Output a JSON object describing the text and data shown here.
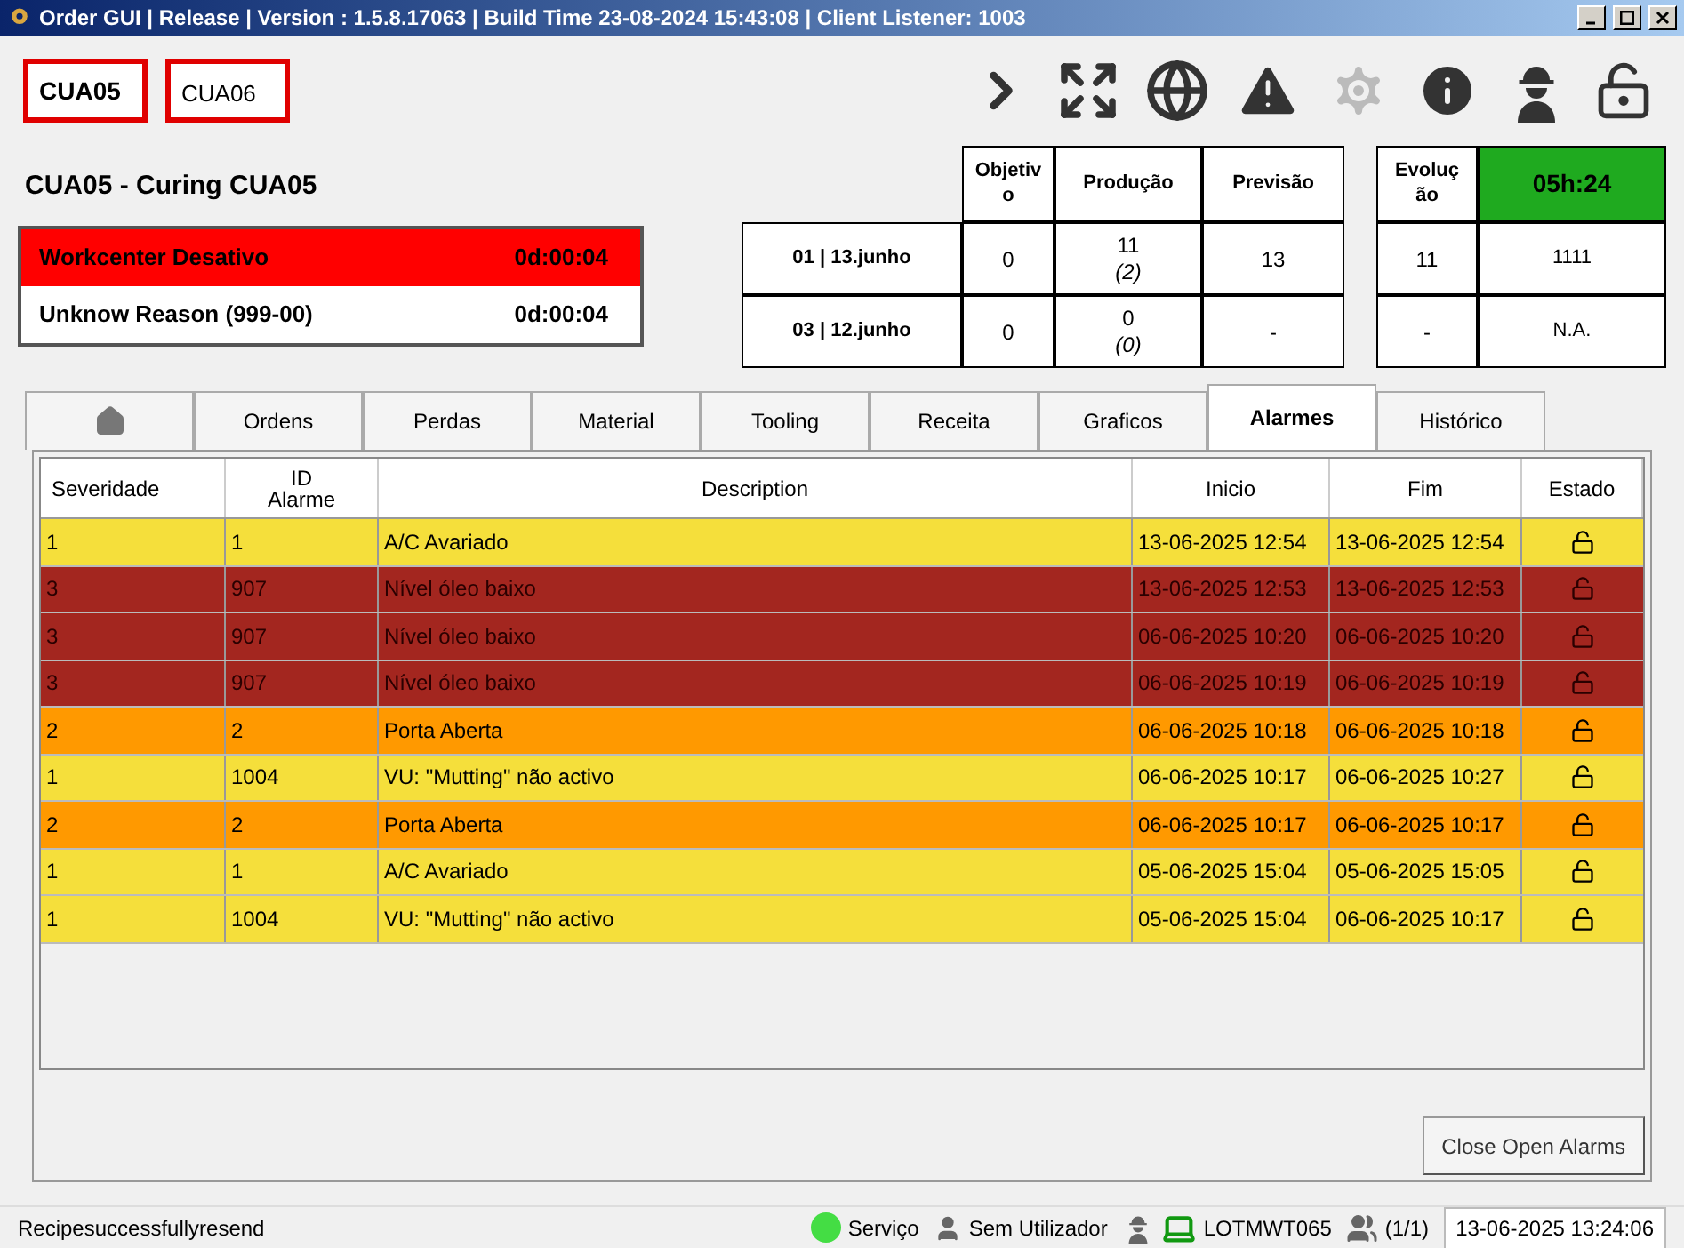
{
  "window": {
    "title": "Order GUI | Release | Version : 1.5.8.17063 | Build Time 23-08-2024 15:43:08 | Client Listener: 1003"
  },
  "stations": [
    {
      "label": "CUA05",
      "selected": true
    },
    {
      "label": "CUA06",
      "selected": false
    }
  ],
  "workcenter": {
    "title": "CUA05 - Curing CUA05",
    "states": [
      {
        "label": "Workcenter Desativo",
        "time": "0d:00:04",
        "color": "#ff0000"
      },
      {
        "label": "Unknow Reason (999-00)",
        "time": "0d:00:04",
        "color": "#ffffff"
      }
    ]
  },
  "stats": {
    "columns": [
      "Objetiv o",
      "Produção",
      "Previsão"
    ],
    "evolution_label": "Evoluç ão",
    "evolution_value": "05h:24",
    "rows": [
      {
        "shift": "01 | 13.junho",
        "objetivo": "0",
        "producao": "11",
        "producao_sub": "(2)",
        "previsao": "13",
        "evolucao": "11",
        "extra": "1111"
      },
      {
        "shift": "03 | 12.junho",
        "objetivo": "0",
        "producao": "0",
        "producao_sub": "(0)",
        "previsao": "-",
        "evolucao": "-",
        "extra": "N.A."
      }
    ]
  },
  "tabs": [
    {
      "kind": "home",
      "selected": false
    },
    {
      "kind": "text",
      "label": "Ordens",
      "selected": false
    },
    {
      "kind": "text",
      "label": "Perdas",
      "selected": false
    },
    {
      "kind": "text",
      "label": "Material",
      "selected": false
    },
    {
      "kind": "text",
      "label": "Tooling",
      "selected": false
    },
    {
      "kind": "text",
      "label": "Receita",
      "selected": false
    },
    {
      "kind": "text",
      "label": "Graficos",
      "selected": false
    },
    {
      "kind": "text",
      "label": "Alarmes",
      "selected": true
    },
    {
      "kind": "text",
      "label": "Histórico",
      "selected": false
    }
  ],
  "table": {
    "columns": [
      "Severidade",
      "ID Alarme",
      "Description",
      "Inicio",
      "Fim",
      "Estado"
    ],
    "rows": [
      {
        "severity": "1",
        "id": "1",
        "description": "A/C Avariado",
        "start": "13-06-2025 12:54",
        "end": "13-06-2025 12:54",
        "color": "#f5df3b"
      },
      {
        "severity": "3",
        "id": "907",
        "description": "Nível óleo baixo",
        "start": "13-06-2025 12:53",
        "end": "13-06-2025 12:53",
        "color": "#a3261f"
      },
      {
        "severity": "3",
        "id": "907",
        "description": "Nível óleo baixo",
        "start": "06-06-2025 10:20",
        "end": "06-06-2025 10:20",
        "color": "#a3261f"
      },
      {
        "severity": "3",
        "id": "907",
        "description": "Nível óleo baixo",
        "start": "06-06-2025 10:19",
        "end": "06-06-2025 10:19",
        "color": "#a3261f"
      },
      {
        "severity": "2",
        "id": "2",
        "description": "Porta Aberta",
        "start": "06-06-2025 10:18",
        "end": "06-06-2025 10:18",
        "color": "#ff9900"
      },
      {
        "severity": "1",
        "id": "1004",
        "description": "VU: \"Mutting\" não activo",
        "start": "06-06-2025 10:17",
        "end": "06-06-2025 10:27",
        "color": "#f5df3b"
      },
      {
        "severity": "2",
        "id": "2",
        "description": "Porta Aberta",
        "start": "06-06-2025 10:17",
        "end": "06-06-2025 10:17",
        "color": "#ff9900"
      },
      {
        "severity": "1",
        "id": "1",
        "description": "A/C Avariado",
        "start": "05-06-2025 15:04",
        "end": "05-06-2025 15:05",
        "color": "#f5df3b"
      },
      {
        "severity": "1",
        "id": "1004",
        "description": "VU: \"Mutting\" não activo",
        "start": "05-06-2025 15:04",
        "end": "06-06-2025 10:17",
        "color": "#f5df3b"
      }
    ]
  },
  "close_button": "Close Open Alarms",
  "status_bar": {
    "message": "Recipesuccessfullyresend",
    "service": {
      "label": "Serviço",
      "color": "#44dd44"
    },
    "user": "Sem Utilizador",
    "machine": "LOTMWT065",
    "sessions": "(1/1)",
    "datetime": "13-06-2025 13:24:06"
  }
}
